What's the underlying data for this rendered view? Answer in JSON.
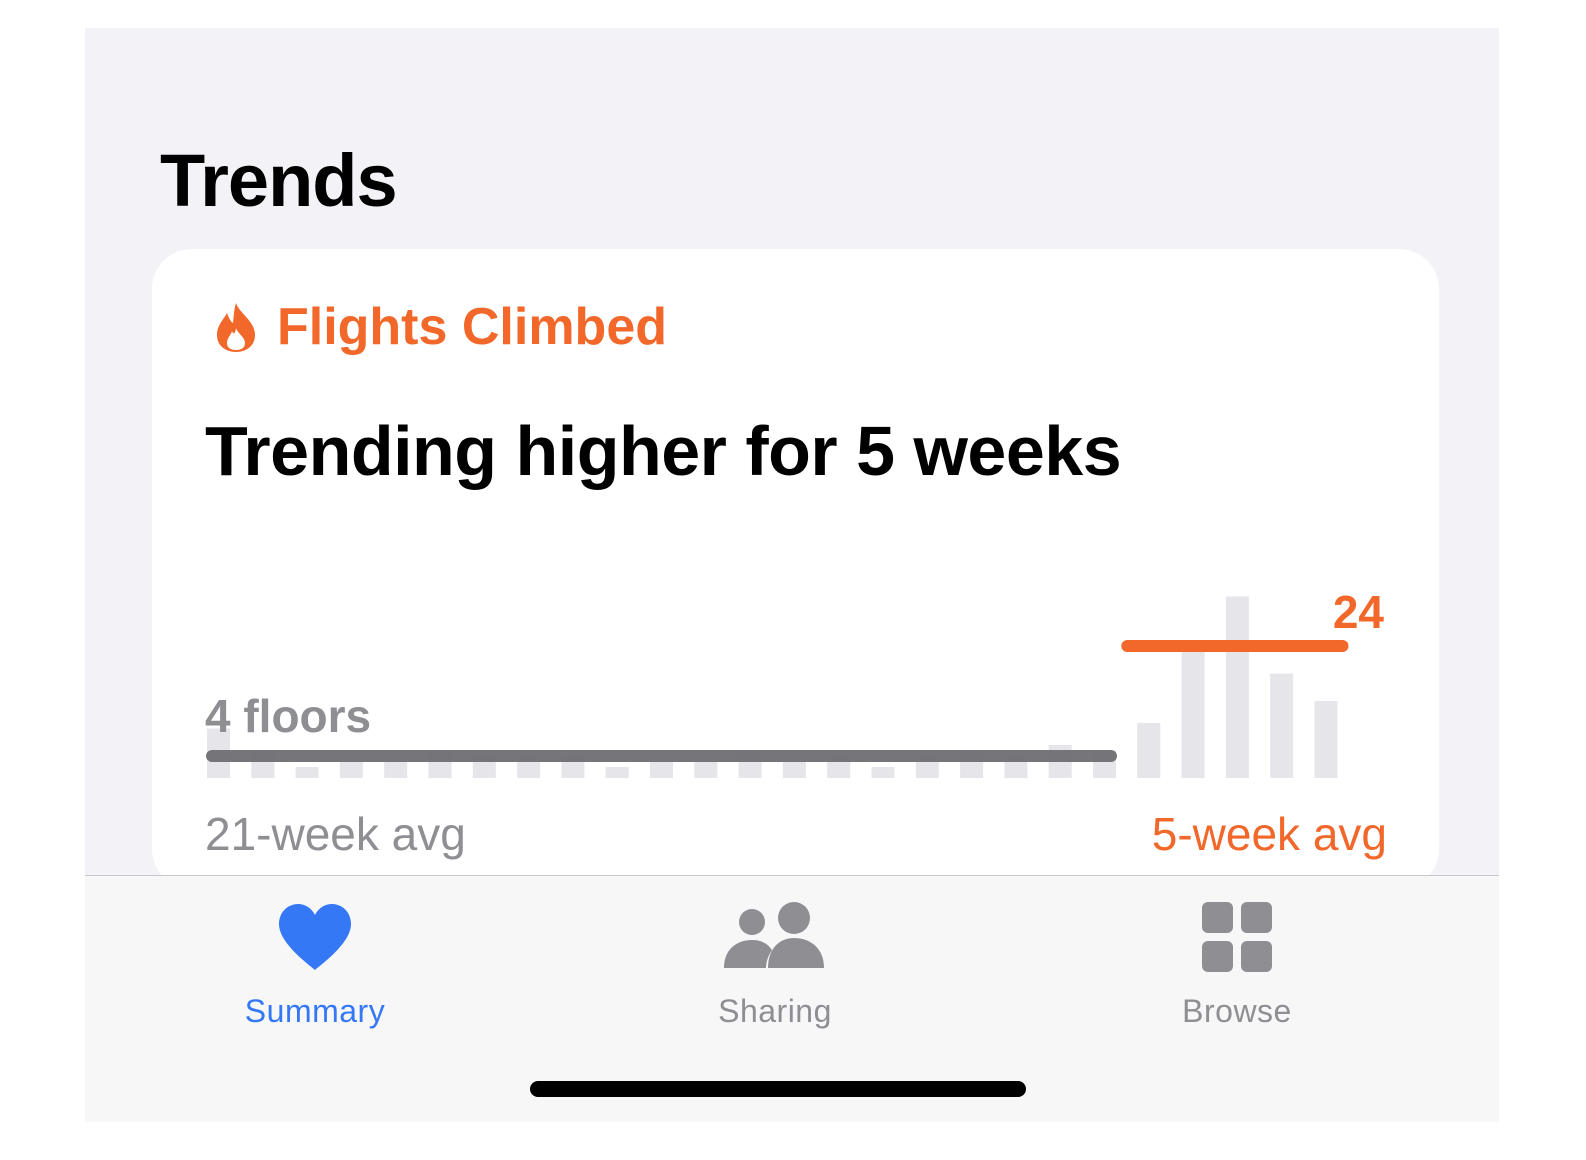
{
  "page": {
    "section_title": "Trends"
  },
  "card": {
    "category": "Flights Climbed",
    "category_icon": "flame-icon",
    "headline": "Trending higher for 5 weeks",
    "accent_color": "#f2672a"
  },
  "chart_data": {
    "type": "bar",
    "past_value_label": "4 floors",
    "recent_value_label": "24",
    "past_caption": "21-week avg",
    "recent_caption": "5-week avg",
    "past_avg": 4,
    "recent_avg": 24,
    "past_values": [
      9,
      5,
      2,
      3,
      3,
      5,
      4,
      4,
      4,
      2,
      3,
      3,
      5,
      3,
      4,
      2,
      4,
      5,
      4,
      6,
      5
    ],
    "recent_values": [
      10,
      23,
      33,
      19,
      14
    ],
    "past_color": "#e5e5ea",
    "past_line_color": "#6e6e73",
    "recent_color": "#f2672a"
  },
  "tabbar": {
    "items": [
      {
        "label": "Summary",
        "icon": "heart-icon",
        "active": true
      },
      {
        "label": "Sharing",
        "icon": "people-icon",
        "active": false
      },
      {
        "label": "Browse",
        "icon": "grid-icon",
        "active": false
      }
    ],
    "active_color": "#3478f6",
    "inactive_color": "#8e8e93"
  }
}
